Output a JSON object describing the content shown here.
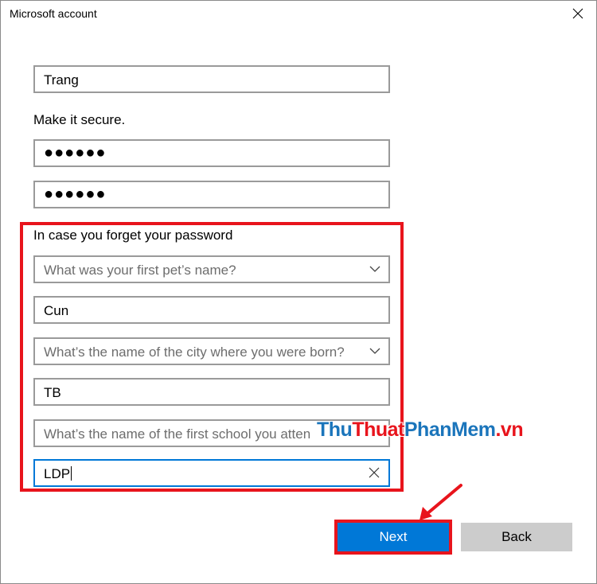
{
  "window": {
    "title": "Microsoft account"
  },
  "form": {
    "name_value": "Trang",
    "secure_label": "Make it secure.",
    "password_value": "●●●●●●",
    "confirm_password_value": "●●●●●●",
    "recovery_label": "In case you forget your password",
    "question1_placeholder": "What was your first pet’s name?",
    "answer1_value": "Cun",
    "question2_placeholder": "What’s the name of the city where you were born?",
    "answer2_value": "TB",
    "question3_placeholder": "What’s the name of the first school you atten",
    "answer3_value": "LDP"
  },
  "buttons": {
    "next_label": "Next",
    "back_label": "Back"
  },
  "watermark": {
    "part1": "Thu",
    "part2": "Thuat",
    "part3": "PhanMem",
    "part4": ".vn"
  },
  "colors": {
    "accent": "#0078d7",
    "highlight": "#e8141c",
    "field_border": "#9a9a9a"
  }
}
